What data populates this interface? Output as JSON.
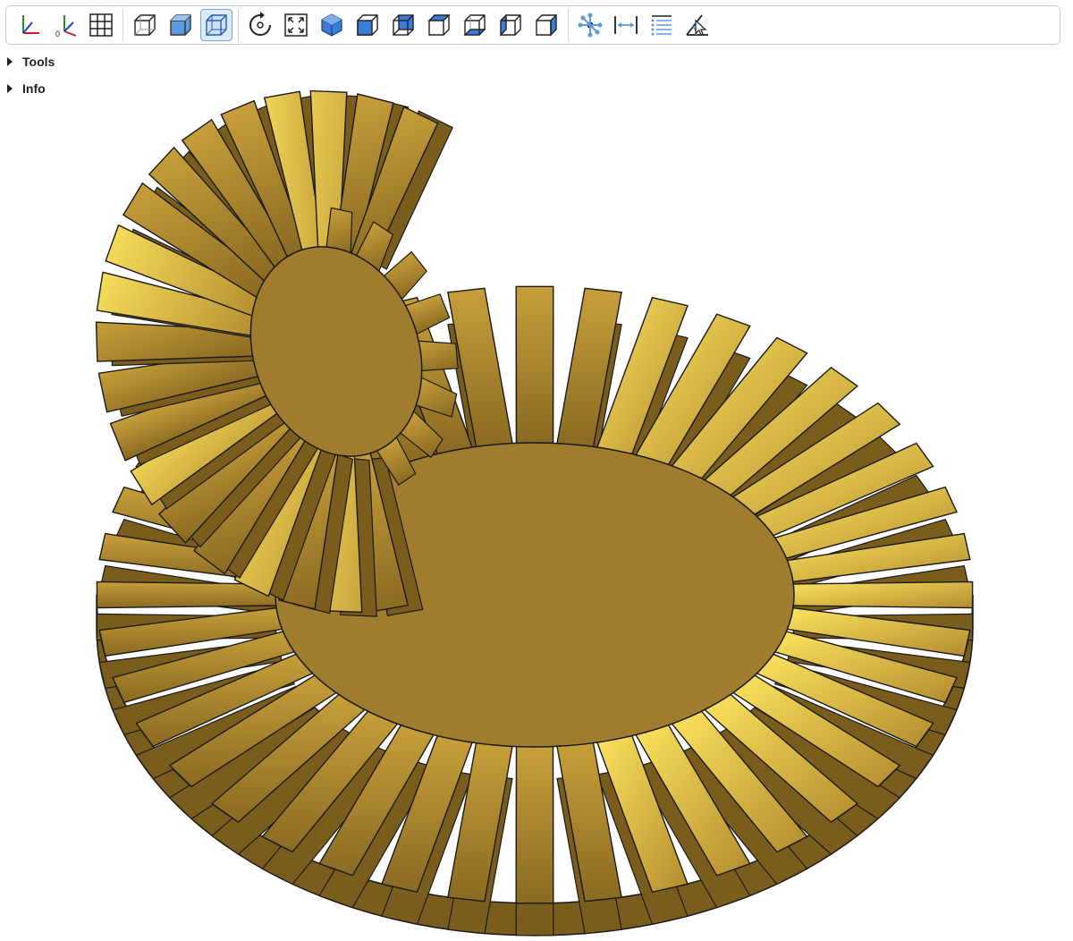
{
  "toolbar": {
    "buttons": [
      {
        "name": "axes-button",
        "icon": "axes-icon",
        "active": false
      },
      {
        "name": "axes-origin-button",
        "icon": "axes-origin-icon",
        "active": false
      },
      {
        "name": "grid-button",
        "icon": "grid-icon",
        "active": false
      },
      {
        "sep": true
      },
      {
        "name": "transparent-button",
        "icon": "transparent-cube-icon",
        "active": false
      },
      {
        "name": "black-edges-button",
        "icon": "solid-cube-icon",
        "active": false
      },
      {
        "name": "ortho-button",
        "icon": "wireframe-cube-icon",
        "active": true
      },
      {
        "sep": true
      },
      {
        "name": "reset-view-button",
        "icon": "reset-icon",
        "active": false
      },
      {
        "name": "fit-view-button",
        "icon": "fit-icon",
        "active": false
      },
      {
        "name": "iso-view-button",
        "icon": "iso-view-icon",
        "active": false
      },
      {
        "name": "front-view-button",
        "icon": "front-view-icon",
        "active": false
      },
      {
        "name": "rear-view-button",
        "icon": "rear-view-icon",
        "active": false
      },
      {
        "name": "top-view-button",
        "icon": "top-view-icon",
        "active": false
      },
      {
        "name": "bottom-view-button",
        "icon": "bottom-view-icon",
        "active": false
      },
      {
        "name": "left-view-button",
        "icon": "left-view-icon",
        "active": false
      },
      {
        "name": "right-view-button",
        "icon": "right-view-icon",
        "active": false
      },
      {
        "sep": true
      },
      {
        "name": "explode-button",
        "icon": "explode-icon",
        "active": false
      },
      {
        "name": "distance-button",
        "icon": "distance-icon",
        "active": false
      },
      {
        "name": "properties-button",
        "icon": "properties-icon",
        "active": false
      },
      {
        "name": "angle-button",
        "icon": "angle-icon",
        "active": false
      }
    ]
  },
  "panels": {
    "tools_label": "Tools",
    "info_label": "Info"
  },
  "viewport": {
    "gear_color": "#a07c2e",
    "highlight_color": "#fce35e",
    "shadow_color": "#7a5d1c",
    "edge_color": "#1a1a1a",
    "large_gear_teeth": 40,
    "small_gear_teeth": 20
  }
}
